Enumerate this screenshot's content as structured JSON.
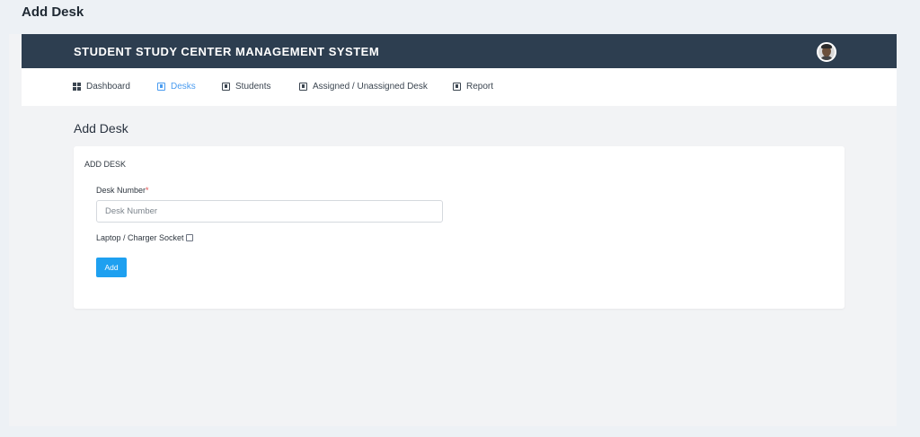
{
  "document_title": "Add Desk",
  "header": {
    "brand": "STUDENT STUDY CENTER MANAGEMENT SYSTEM",
    "avatar_icon": "user-avatar-icon",
    "background_color": "#2d3e50"
  },
  "nav": {
    "items": [
      {
        "label": "Dashboard",
        "icon": "dashboard-grid-icon",
        "active": false
      },
      {
        "label": "Desks",
        "icon": "book-icon",
        "active": true
      },
      {
        "label": "Students",
        "icon": "book-icon",
        "active": false
      },
      {
        "label": "Assigned / Unassigned Desk",
        "icon": "book-icon",
        "active": false
      },
      {
        "label": "Report",
        "icon": "book-icon",
        "active": false
      }
    ],
    "active_color": "#4a9cf0"
  },
  "page": {
    "heading": "Add Desk"
  },
  "form": {
    "card_title": "ADD DESK",
    "desk_number_label": "Desk Number",
    "required_marker": "*",
    "desk_number_placeholder": "Desk Number",
    "desk_number_value": "",
    "laptop_socket_label": "Laptop / Charger Socket",
    "laptop_socket_checked": false,
    "submit_label": "Add",
    "submit_color": "#1ea0f0"
  }
}
